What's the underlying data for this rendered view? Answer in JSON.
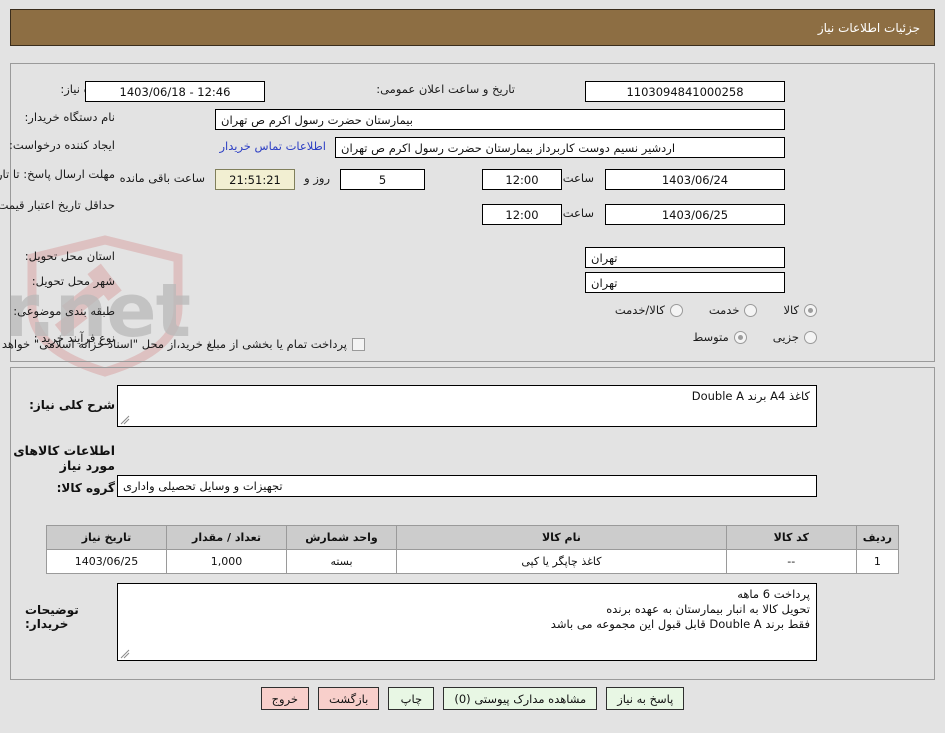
{
  "header": {
    "title": "جزئیات اطلاعات نیاز",
    "bg_color": "#8d6e43"
  },
  "form": {
    "need_number_label": "شماره نیاز:",
    "need_number_value": "1103094841000258",
    "announce_label": "تاریخ و ساعت اعلان عمومی:",
    "announce_value": "1403/06/18 - 12:46",
    "buyer_org_label": "نام دستگاه خریدار:",
    "buyer_org_value": "بیمارستان حضرت رسول اکرم ص  تهران",
    "requester_label": "ایجاد کننده درخواست:",
    "requester_value": "اردشیر  نسیم دوست کاربرداز بیمارستان حضرت رسول اکرم ص  تهران",
    "contact_link": "اطلاعات تماس خریدار",
    "deadline_label": "مهلت ارسال پاسخ: تا تاریخ:",
    "deadline_date": "1403/06/24",
    "deadline_hour_label": "ساعت",
    "deadline_hour": "12:00",
    "days_remaining": "5",
    "days_word": "روز و",
    "countdown": "21:51:21",
    "countdown_suffix": "ساعت باقی مانده",
    "validity_label": "حداقل تاریخ اعتبار قیمت: تا تاریخ:",
    "validity_date": "1403/06/25",
    "validity_hour_label": "ساعت",
    "validity_hour": "12:00",
    "province_label": "استان محل تحویل:",
    "province_value": "تهران",
    "city_label": "شهر محل تحویل:",
    "city_value": "تهران",
    "category_label": "طبقه بندی موضوعی:",
    "category_options": [
      {
        "label": "کالا",
        "selected": true
      },
      {
        "label": "خدمت",
        "selected": false
      },
      {
        "label": "کالا/خدمت",
        "selected": false
      }
    ],
    "process_label": "نوع فرآیند خرید :",
    "process_options": [
      {
        "label": "جزیی",
        "selected": false
      },
      {
        "label": "متوسط",
        "selected": true
      }
    ],
    "treasury_checkbox_label": "پرداخت تمام یا بخشی از مبلغ خرید،از محل \"اسناد خزانه اسلامی\" خواهد بود.",
    "treasury_checked": false
  },
  "detail": {
    "summary_label": "شرح کلی نیاز:",
    "summary_value": "کاغذ A4 برند Double A",
    "goods_section_title": "اطلاعات کالاهای مورد نیاز",
    "group_label": "گروه کالا:",
    "group_value": "تجهیزات و وسایل تحصیلی واداری"
  },
  "table": {
    "columns": [
      "ردیف",
      "کد کالا",
      "نام کالا",
      "واحد شمارش",
      "تعداد / مقدار",
      "تاریخ نیاز"
    ],
    "rows": [
      [
        "1",
        "--",
        "کاغذ چاپگر یا کپی",
        "بسته",
        "1,000",
        "1403/06/25"
      ]
    ]
  },
  "notes": {
    "label_line1": "توضیحات",
    "label_line2": "خریدار:",
    "lines": [
      "پرداخت 6 ماهه",
      "تحویل کالا به انبار بیمارستان به عهده برنده",
      "فقط برند Double A قابل قبول این مجموعه می باشد"
    ]
  },
  "buttons": [
    {
      "label": "پاسخ به نیاز",
      "style": "green",
      "name": "respond-to-need-button"
    },
    {
      "label": "مشاهده مدارک پیوستی (0)",
      "style": "green",
      "name": "view-attachments-button"
    },
    {
      "label": "چاپ",
      "style": "green",
      "name": "print-button"
    },
    {
      "label": "بازگشت",
      "style": "pink",
      "name": "back-button"
    },
    {
      "label": "خروج",
      "style": "pink",
      "name": "exit-button"
    }
  ],
  "watermark": {
    "text": "AriaTender.net"
  }
}
